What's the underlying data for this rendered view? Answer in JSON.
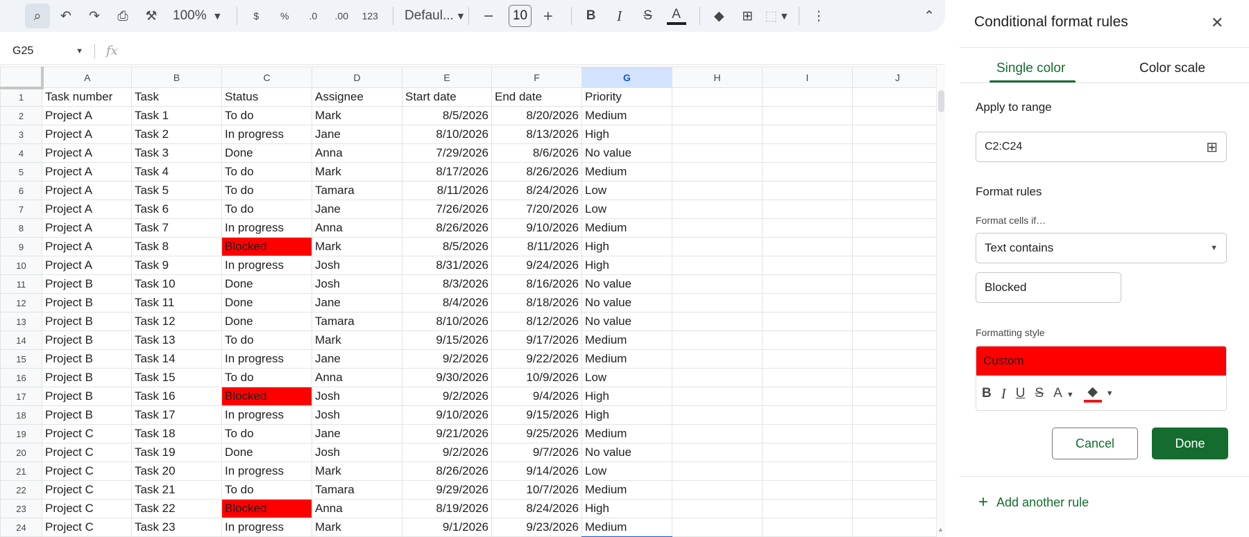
{
  "toolbar": {
    "zoom": "100%",
    "font": "Defaul...",
    "font_size": "10",
    "currency": "$",
    "percent": "%",
    "decrease_decimal": ".0",
    "increase_decimal": ".00",
    "number_format": "123",
    "bold": "B",
    "italic": "I",
    "strike": "S",
    "text_color": "A"
  },
  "formula_bar": {
    "cell_ref": "G25",
    "fx": "fx"
  },
  "columns": [
    "A",
    "B",
    "C",
    "D",
    "E",
    "F",
    "G",
    "H",
    "I",
    "J"
  ],
  "rows": [
    [
      "Task number",
      "Task",
      "Status",
      "Assignee",
      "Start date",
      "End date",
      "Priority"
    ],
    [
      "Project A",
      "Task 1",
      "To do",
      "Mark",
      "8/5/2026",
      "8/20/2026",
      "Medium"
    ],
    [
      "Project A",
      "Task 2",
      "In progress",
      "Jane",
      "8/10/2026",
      "8/13/2026",
      "High"
    ],
    [
      "Project A",
      "Task 3",
      "Done",
      "Anna",
      "7/29/2026",
      "8/6/2026",
      "No value"
    ],
    [
      "Project A",
      "Task 4",
      "To do",
      "Mark",
      "8/17/2026",
      "8/26/2026",
      "Medium"
    ],
    [
      "Project A",
      "Task 5",
      "To do",
      "Tamara",
      "8/11/2026",
      "8/24/2026",
      "Low"
    ],
    [
      "Project A",
      "Task 6",
      "To do",
      "Jane",
      "7/26/2026",
      "7/20/2026",
      "Low"
    ],
    [
      "Project A",
      "Task 7",
      "In progress",
      "Anna",
      "8/26/2026",
      "9/10/2026",
      "Medium"
    ],
    [
      "Project A",
      "Task 8",
      "Blocked",
      "Mark",
      "8/5/2026",
      "8/11/2026",
      "High"
    ],
    [
      "Project A",
      "Task 9",
      "In progress",
      "Josh",
      "8/31/2026",
      "9/24/2026",
      "High"
    ],
    [
      "Project B",
      "Task 10",
      "Done",
      "Josh",
      "8/3/2026",
      "8/16/2026",
      "No value"
    ],
    [
      "Project B",
      "Task 11",
      "Done",
      "Jane",
      "8/4/2026",
      "8/18/2026",
      "No value"
    ],
    [
      "Project B",
      "Task 12",
      "Done",
      "Tamara",
      "8/10/2026",
      "8/12/2026",
      "No value"
    ],
    [
      "Project B",
      "Task 13",
      "To do",
      "Mark",
      "9/15/2026",
      "9/17/2026",
      "Medium"
    ],
    [
      "Project B",
      "Task 14",
      "In progress",
      "Jane",
      "9/2/2026",
      "9/22/2026",
      "Medium"
    ],
    [
      "Project B",
      "Task 15",
      "To do",
      "Anna",
      "9/30/2026",
      "10/9/2026",
      "Low"
    ],
    [
      "Project B",
      "Task 16",
      "Blocked",
      "Josh",
      "9/2/2026",
      "9/4/2026",
      "High"
    ],
    [
      "Project B",
      "Task 17",
      "In progress",
      "Josh",
      "9/10/2026",
      "9/15/2026",
      "High"
    ],
    [
      "Project C",
      "Task 18",
      "To do",
      "Jane",
      "9/21/2026",
      "9/25/2026",
      "Medium"
    ],
    [
      "Project C",
      "Task 19",
      "Done",
      "Josh",
      "9/2/2026",
      "9/7/2026",
      "No value"
    ],
    [
      "Project C",
      "Task 20",
      "In progress",
      "Mark",
      "8/26/2026",
      "9/14/2026",
      "Low"
    ],
    [
      "Project C",
      "Task 21",
      "To do",
      "Tamara",
      "9/29/2026",
      "10/7/2026",
      "Medium"
    ],
    [
      "Project C",
      "Task 22",
      "Blocked",
      "Anna",
      "8/19/2026",
      "8/24/2026",
      "High"
    ],
    [
      "Project C",
      "Task 23",
      "In progress",
      "Mark",
      "9/1/2026",
      "9/23/2026",
      "Medium"
    ]
  ],
  "highlight_text": "Blocked",
  "highlight_color": "#ff0000",
  "selected_column": "G",
  "panel": {
    "title": "Conditional format rules",
    "tabs": [
      "Single color",
      "Color scale"
    ],
    "apply_to_range_label": "Apply to range",
    "range": "C2:C24",
    "format_rules_label": "Format rules",
    "format_cells_if_label": "Format cells if…",
    "condition": "Text contains",
    "value": "Blocked",
    "formatting_style_label": "Formatting style",
    "style_preview": "Custom",
    "style_tools": {
      "bold": "B",
      "italic": "I",
      "underline": "U",
      "strike": "S",
      "text_color": "A"
    },
    "cancel": "Cancel",
    "done": "Done",
    "add_rule": "Add another rule"
  },
  "colors": {
    "accent_green": "#146c2e",
    "selection_blue": "#0b57d0",
    "toolbar_bg": "#f0f4f9"
  }
}
